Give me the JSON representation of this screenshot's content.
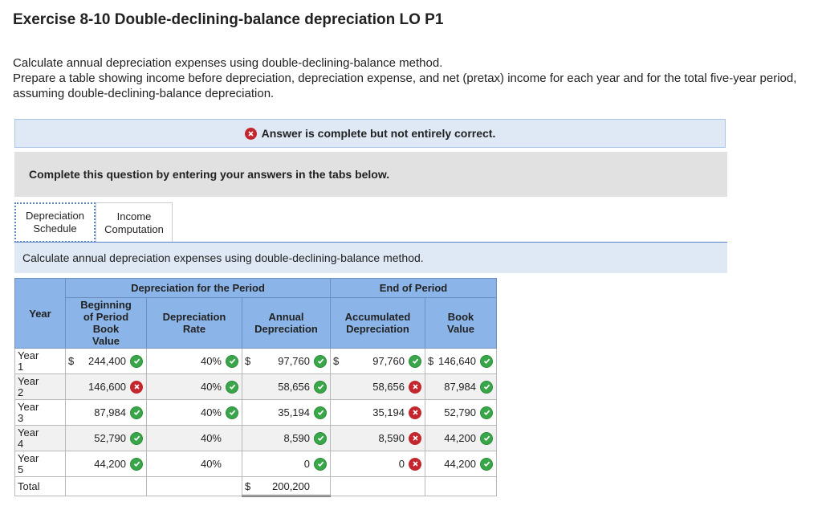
{
  "title": "Exercise 8-10 Double-declining-balance depreciation LO P1",
  "instructions": [
    "Calculate annual depreciation expenses using double-declining-balance method.",
    "Prepare a table showing income before depreciation, depreciation expense, and net (pretax) income for each year and for the total five-year period, assuming double-declining-balance depreciation."
  ],
  "result_banner": "Answer is complete but not entirely correct.",
  "prompt": "Complete this question by entering your answers in the tabs below.",
  "tabs": [
    {
      "line1": "Depreciation",
      "line2": "Schedule"
    },
    {
      "line1": "Income",
      "line2": "Computation"
    }
  ],
  "panel_header": "Calculate annual depreciation expenses using double-declining-balance method.",
  "table": {
    "group_headers": {
      "period": "Depreciation for the Period",
      "end": "End of Period"
    },
    "columns": {
      "year": "Year",
      "beginning": [
        "Beginning",
        "of Period",
        "Book",
        "Value"
      ],
      "rate": [
        "Depreciation",
        "Rate"
      ],
      "annual": [
        "Annual",
        "Depreciation"
      ],
      "accumulated": [
        "Accumulated",
        "Depreciation"
      ],
      "book": [
        "Book",
        "Value"
      ]
    },
    "currency": "$",
    "rows": [
      {
        "year": [
          "Year",
          "1"
        ],
        "beginning": "244,400",
        "beginning_status": "correct",
        "rate": "40%",
        "rate_status": "correct",
        "annual": "97,760",
        "annual_status": "correct",
        "accumulated": "97,760",
        "accumulated_status": "correct",
        "book": "146,640",
        "book_status": "correct"
      },
      {
        "year": [
          "Year",
          "2"
        ],
        "beginning": "146,600",
        "beginning_status": "incorrect",
        "rate": "40%",
        "rate_status": "correct",
        "annual": "58,656",
        "annual_status": "correct",
        "accumulated": "58,656",
        "accumulated_status": "incorrect",
        "book": "87,984",
        "book_status": "correct"
      },
      {
        "year": [
          "Year",
          "3"
        ],
        "beginning": "87,984",
        "beginning_status": "correct",
        "rate": "40%",
        "rate_status": "correct",
        "annual": "35,194",
        "annual_status": "correct",
        "accumulated": "35,194",
        "accumulated_status": "incorrect",
        "book": "52,790",
        "book_status": "correct"
      },
      {
        "year": [
          "Year",
          "4"
        ],
        "beginning": "52,790",
        "beginning_status": "correct",
        "rate": "40%",
        "rate_status": "none",
        "annual": "8,590",
        "annual_status": "correct",
        "accumulated": "8,590",
        "accumulated_status": "incorrect",
        "book": "44,200",
        "book_status": "correct"
      },
      {
        "year": [
          "Year",
          "5"
        ],
        "beginning": "44,200",
        "beginning_status": "correct",
        "rate": "40%",
        "rate_status": "none",
        "annual": "0",
        "annual_status": "correct",
        "accumulated": "0",
        "accumulated_status": "incorrect",
        "book": "44,200",
        "book_status": "correct"
      }
    ],
    "total": {
      "label": "Total",
      "annual": "200,200"
    }
  },
  "icons": {
    "correct": "check-circle-icon",
    "incorrect": "x-circle-icon"
  },
  "colors": {
    "correct": "#3aa64a",
    "incorrect": "#c4262e",
    "header_blue": "#8bb5e8",
    "banner_blue": "#dfe9f6"
  }
}
